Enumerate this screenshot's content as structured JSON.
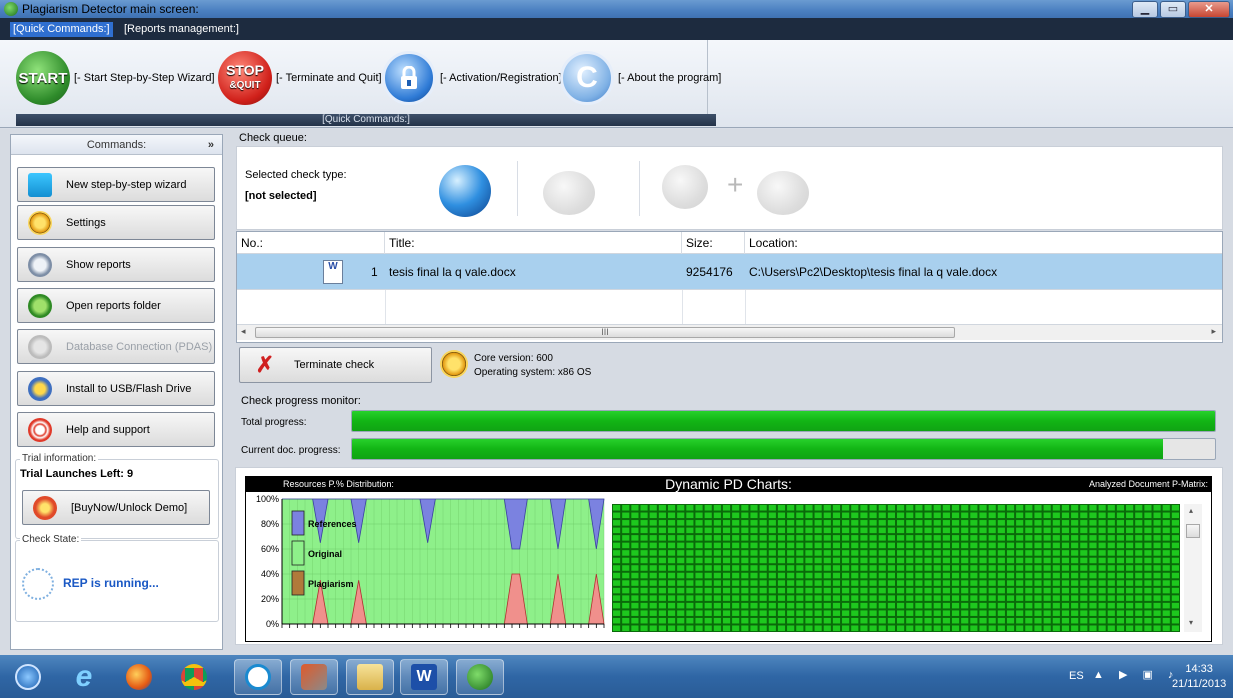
{
  "window": {
    "title": "Plagiarism Detector main screen:"
  },
  "menu": {
    "tabs": [
      "[Quick Commands:]",
      "[Reports management:]"
    ]
  },
  "ribbon": {
    "start_icon": "START",
    "stop_icon_line1": "STOP",
    "stop_icon_line2": "&QUIT",
    "about_icon": "C",
    "start_label": "[- Start Step-by-Step Wizard]",
    "terminate_label": "[- Terminate and Quit]",
    "activation_label": "[- Activation/Registration]",
    "about_label": "[- About the program]",
    "group_label": "[Quick Commands:]"
  },
  "sidebar": {
    "header": "Commands:",
    "chevron": "»",
    "items": [
      {
        "label": "New step-by-step wizard",
        "icon": "wizard-icon",
        "enabled": true
      },
      {
        "label": "Settings",
        "icon": "settings-gear-icon",
        "enabled": true
      },
      {
        "label": "Show reports",
        "icon": "reports-icon",
        "enabled": true
      },
      {
        "label": "Open reports folder",
        "icon": "folder-icon",
        "enabled": true
      },
      {
        "label": "Database Connection (PDAS)",
        "icon": "database-icon",
        "enabled": false
      },
      {
        "label": "Install to USB/Flash Drive",
        "icon": "usb-icon",
        "enabled": true
      },
      {
        "label": "Help and support",
        "icon": "help-lifebuoy-icon",
        "enabled": true
      }
    ],
    "trial_legend": "Trial information:",
    "trial_text": "Trial Launches Left: 9",
    "buy_label": "[BuyNow/Unlock Demo]",
    "check_legend": "Check State:",
    "check_status": "REP is running..."
  },
  "queue": {
    "label": "Check queue:",
    "type_label": "Selected check type:",
    "type_value": "[not selected]",
    "plus": "+"
  },
  "table": {
    "columns": [
      "No.:",
      "Title:",
      "Size:",
      "Location:"
    ],
    "rows": [
      {
        "no": "1",
        "title": "tesis final la q vale.docx",
        "size": "9254176",
        "location": "C:\\Users\\Pc2\\Desktop\\tesis final la q vale.docx"
      }
    ],
    "doc_icon": "W",
    "scroll_thumb": "III"
  },
  "terminate": {
    "label": "Terminate check"
  },
  "core": {
    "version": "Core version: 600",
    "os": "Operating system: x86 OS"
  },
  "progress": {
    "monitor_label": "Check progress monitor:",
    "total_label": "Total progress:",
    "total_value": 1.0,
    "current_label": "Current doc. progress:",
    "current_value": 0.94
  },
  "charts": {
    "title": "Dynamic PD Charts:",
    "left_caption": "Resources P.% Distribution:",
    "right_caption": "Analyzed Document P-Matrix:",
    "colors": {
      "references": "#7b82e0",
      "original": "#8ef08a",
      "plagiarism": "#f0908c",
      "matrix": "#1ec81e"
    }
  },
  "chart_data": {
    "type": "area",
    "title": "",
    "xlabel": "",
    "ylabel": "",
    "ylim": [
      0,
      100
    ],
    "yticks": [
      "100%",
      "80%",
      "60%",
      "40%",
      "20%",
      "0%"
    ],
    "legend": [
      "References",
      "Original",
      "Plagiarism"
    ],
    "series": [
      {
        "name": "References",
        "values": [
          0,
          0,
          0,
          0,
          0,
          35,
          0,
          0,
          0,
          0,
          35,
          0,
          0,
          0,
          0,
          0,
          0,
          0,
          0,
          35,
          0,
          0,
          0,
          0,
          0,
          0,
          0,
          0,
          0,
          0,
          40,
          40,
          0,
          0,
          0,
          0,
          40,
          0,
          0,
          0,
          0,
          40,
          0
        ]
      },
      {
        "name": "Plagiarism",
        "values": [
          0,
          0,
          0,
          0,
          0,
          35,
          0,
          0,
          0,
          0,
          35,
          0,
          0,
          0,
          0,
          0,
          0,
          0,
          0,
          0,
          0,
          0,
          0,
          0,
          0,
          0,
          0,
          0,
          0,
          0,
          40,
          40,
          0,
          0,
          0,
          0,
          40,
          0,
          0,
          0,
          0,
          40,
          0
        ]
      }
    ]
  },
  "taskbar": {
    "language": "ES",
    "tray": "▲ ▶ ▣ ♪",
    "time": "14:33",
    "date": "21/11/2013"
  }
}
